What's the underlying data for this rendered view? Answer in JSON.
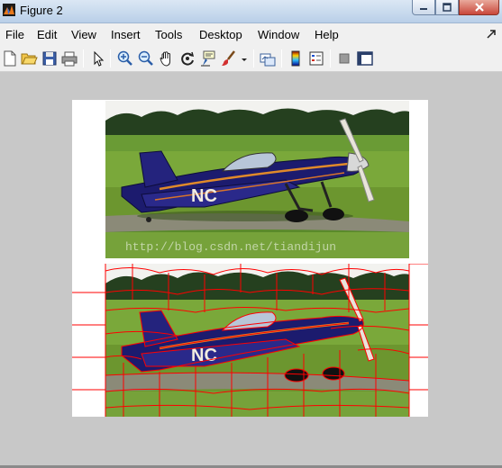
{
  "window": {
    "title": "Figure 2"
  },
  "menu": {
    "items": [
      "File",
      "Edit",
      "View",
      "Insert",
      "Tools",
      "Desktop",
      "Window",
      "Help"
    ]
  },
  "toolbar": {
    "icons": [
      "new-figure-icon",
      "open-file-icon",
      "save-icon",
      "print-icon",
      "edit-plot-icon",
      "zoom-in-icon",
      "zoom-out-icon",
      "pan-icon",
      "rotate-3d-icon",
      "data-cursor-icon",
      "brush-icon",
      "link-plot-icon",
      "colorbar-icon",
      "legend-icon",
      "hide-plot-tools-icon",
      "show-plot-tools-icon"
    ]
  },
  "figure": {
    "watermark": "http://blog.csdn.net/tiandijun",
    "colors": {
      "segment_boundary": "#ff0000",
      "figure_background": "#c8c8c8",
      "axes_background": "#ffffff"
    }
  }
}
